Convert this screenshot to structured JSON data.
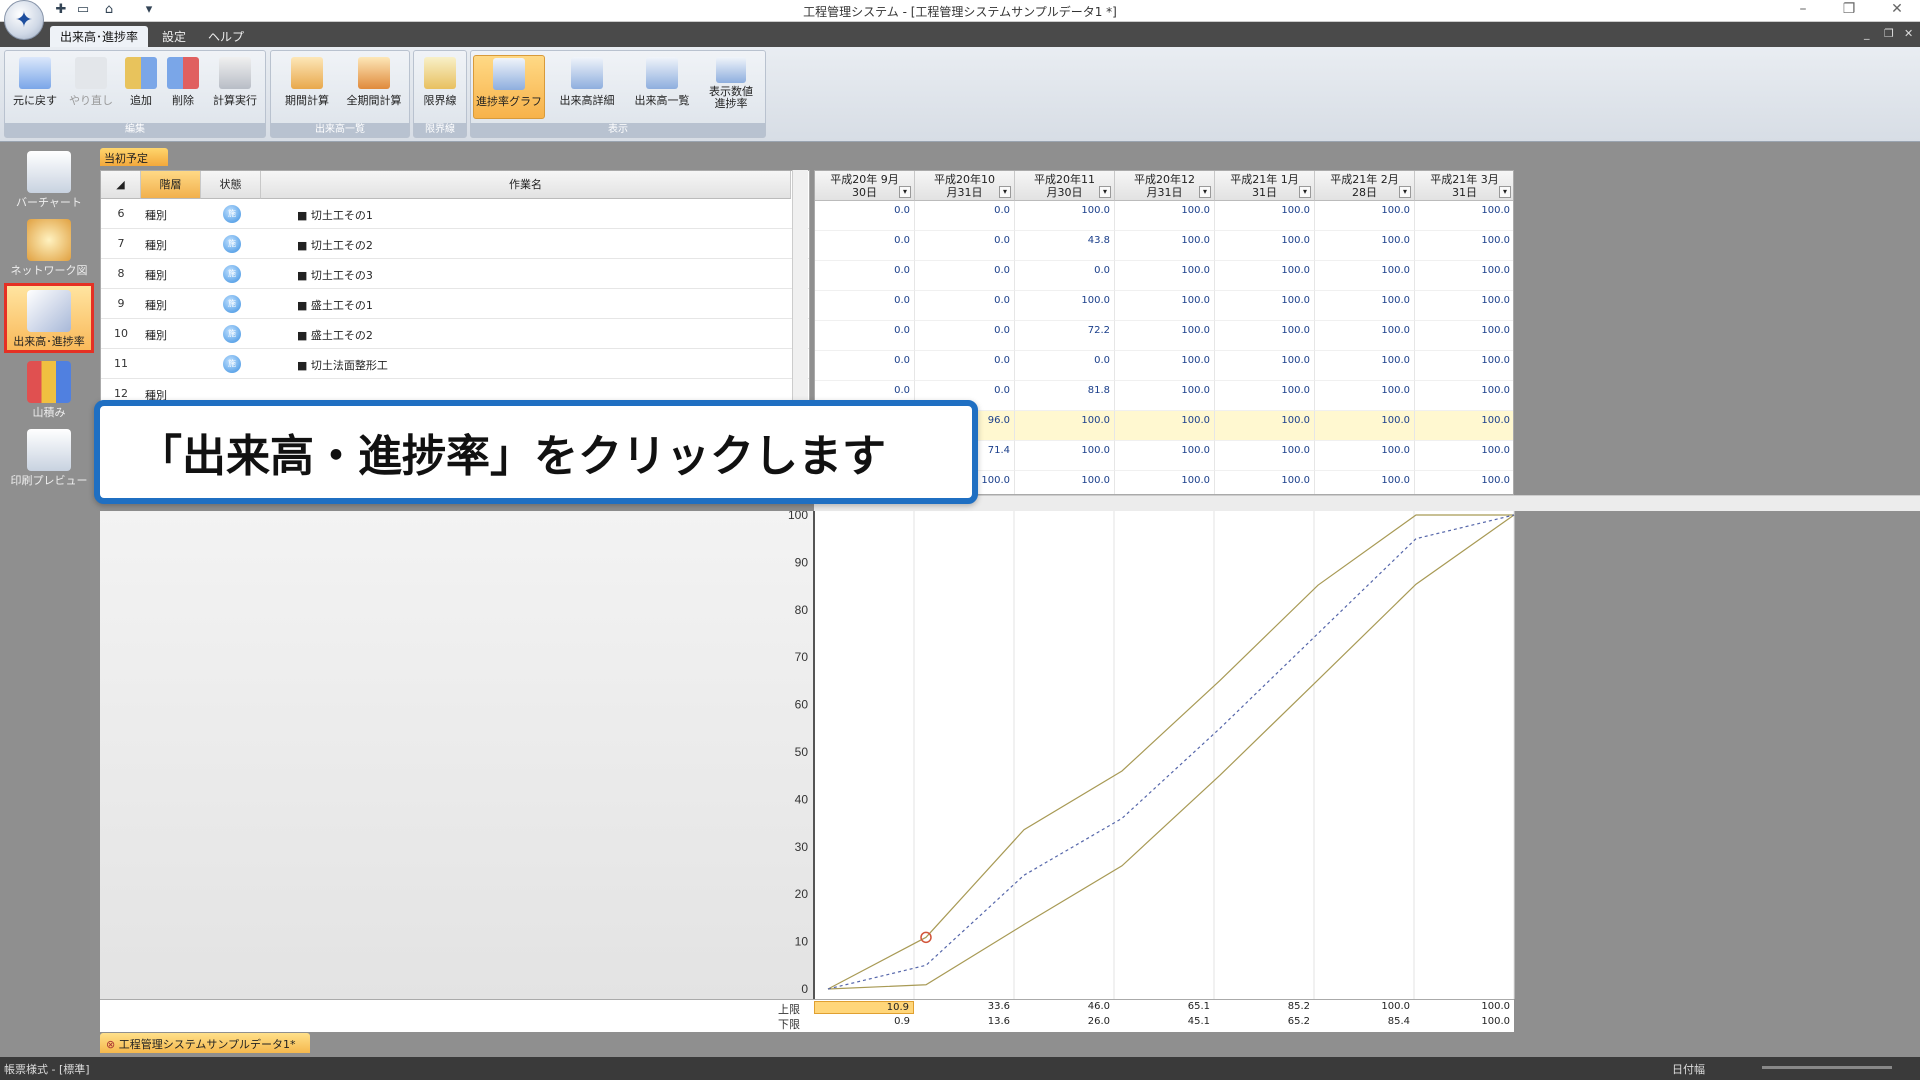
{
  "window": {
    "title": "工程管理システム - [工程管理システムサンプルデータ1 *]"
  },
  "ribbon": {
    "tabs": [
      "出来高･進捗率",
      "設定",
      "ヘルプ"
    ],
    "groups": [
      {
        "label": "編集",
        "buttons": [
          "元に戻す",
          "やり直し",
          "追加",
          "削除",
          "計算実行"
        ]
      },
      {
        "label": "出来高一覧",
        "buttons": [
          "期間計算",
          "全期間計算"
        ]
      },
      {
        "label": "限界線",
        "buttons": [
          "限界線"
        ]
      },
      {
        "label": "表示",
        "buttons": [
          "進捗率グラフ",
          "出来高詳細",
          "出来高一覧",
          "表示数値\n進捗率"
        ]
      }
    ]
  },
  "sidenav": [
    "バーチャート",
    "ネットワーク図",
    "出来高･進捗率",
    "山積み",
    "印刷プレビュー"
  ],
  "plan_tab": "当初予定",
  "grid": {
    "headers": [
      "階層",
      "状態",
      "作業名"
    ],
    "rows": [
      {
        "no": "6",
        "level": "種別",
        "status": "施",
        "name": "■ 切土工その1"
      },
      {
        "no": "7",
        "level": "種別",
        "status": "施",
        "name": "■ 切土工その2"
      },
      {
        "no": "8",
        "level": "種別",
        "status": "施",
        "name": "■ 切土工その3"
      },
      {
        "no": "9",
        "level": "種別",
        "status": "施",
        "name": "■ 盛土工その1"
      },
      {
        "no": "10",
        "level": "種別",
        "status": "施",
        "name": "■ 盛土工その2"
      },
      {
        "no": "11",
        "level": "",
        "status": "施",
        "name": "■ 切土法面整形工"
      },
      {
        "no": "12",
        "level": "種別",
        "status": "",
        "name": ""
      }
    ]
  },
  "periods": [
    {
      "l1": "平成20年 9月",
      "l2": "30日"
    },
    {
      "l1": "平成20年10",
      "l2": "月31日"
    },
    {
      "l1": "平成20年11",
      "l2": "月30日"
    },
    {
      "l1": "平成20年12",
      "l2": "月31日"
    },
    {
      "l1": "平成21年 1月",
      "l2": "31日"
    },
    {
      "l1": "平成21年 2月",
      "l2": "28日"
    },
    {
      "l1": "平成21年 3月",
      "l2": "31日"
    }
  ],
  "values": [
    [
      "0.0",
      "0.0",
      "100.0",
      "100.0",
      "100.0",
      "100.0",
      "100.0"
    ],
    [
      "0.0",
      "0.0",
      "43.8",
      "100.0",
      "100.0",
      "100.0",
      "100.0"
    ],
    [
      "0.0",
      "0.0",
      "0.0",
      "100.0",
      "100.0",
      "100.0",
      "100.0"
    ],
    [
      "0.0",
      "0.0",
      "100.0",
      "100.0",
      "100.0",
      "100.0",
      "100.0"
    ],
    [
      "0.0",
      "0.0",
      "72.2",
      "100.0",
      "100.0",
      "100.0",
      "100.0"
    ],
    [
      "0.0",
      "0.0",
      "0.0",
      "100.0",
      "100.0",
      "100.0",
      "100.0"
    ],
    [
      "0.0",
      "0.0",
      "81.8",
      "100.0",
      "100.0",
      "100.0",
      "100.0"
    ],
    [
      "",
      "96.0",
      "100.0",
      "100.0",
      "100.0",
      "100.0",
      "100.0"
    ],
    [
      "",
      "71.4",
      "100.0",
      "100.0",
      "100.0",
      "100.0",
      "100.0"
    ],
    [
      "",
      "100.0",
      "100.0",
      "100.0",
      "100.0",
      "100.0",
      "100.0"
    ]
  ],
  "chart_data": {
    "type": "line",
    "ylim": [
      0,
      100
    ],
    "yticks": [
      0,
      10,
      20,
      30,
      40,
      50,
      60,
      70,
      80,
      90,
      100
    ],
    "series": [
      {
        "name": "上限",
        "values": [
          0,
          10.9,
          33.6,
          46.0,
          65.1,
          85.2,
          100.0,
          100.0
        ],
        "color": "#a89a55"
      },
      {
        "name": "下限",
        "values": [
          0,
          0.9,
          13.6,
          26.0,
          45.1,
          65.2,
          85.4,
          100.0
        ],
        "color": "#a89a55"
      },
      {
        "values": [
          0,
          5,
          24,
          36,
          55,
          75,
          95,
          100
        ],
        "color": "#5566aa",
        "dashed": true
      }
    ],
    "marker": {
      "value": 10.9,
      "color": "#d2553a"
    }
  },
  "bottom": {
    "upper_label": "上限",
    "lower_label": "下限",
    "upper": [
      "10.9",
      "33.6",
      "46.0",
      "65.1",
      "85.2",
      "100.0",
      "100.0"
    ],
    "lower": [
      "0.9",
      "13.6",
      "26.0",
      "45.1",
      "65.2",
      "85.4",
      "100.0"
    ]
  },
  "doc_tab": "工程管理システムサンプルデータ1*",
  "status": {
    "left": "帳票様式 - [標準]",
    "right": "日付幅"
  },
  "callout": "「出来高・進捗率」をクリックします"
}
